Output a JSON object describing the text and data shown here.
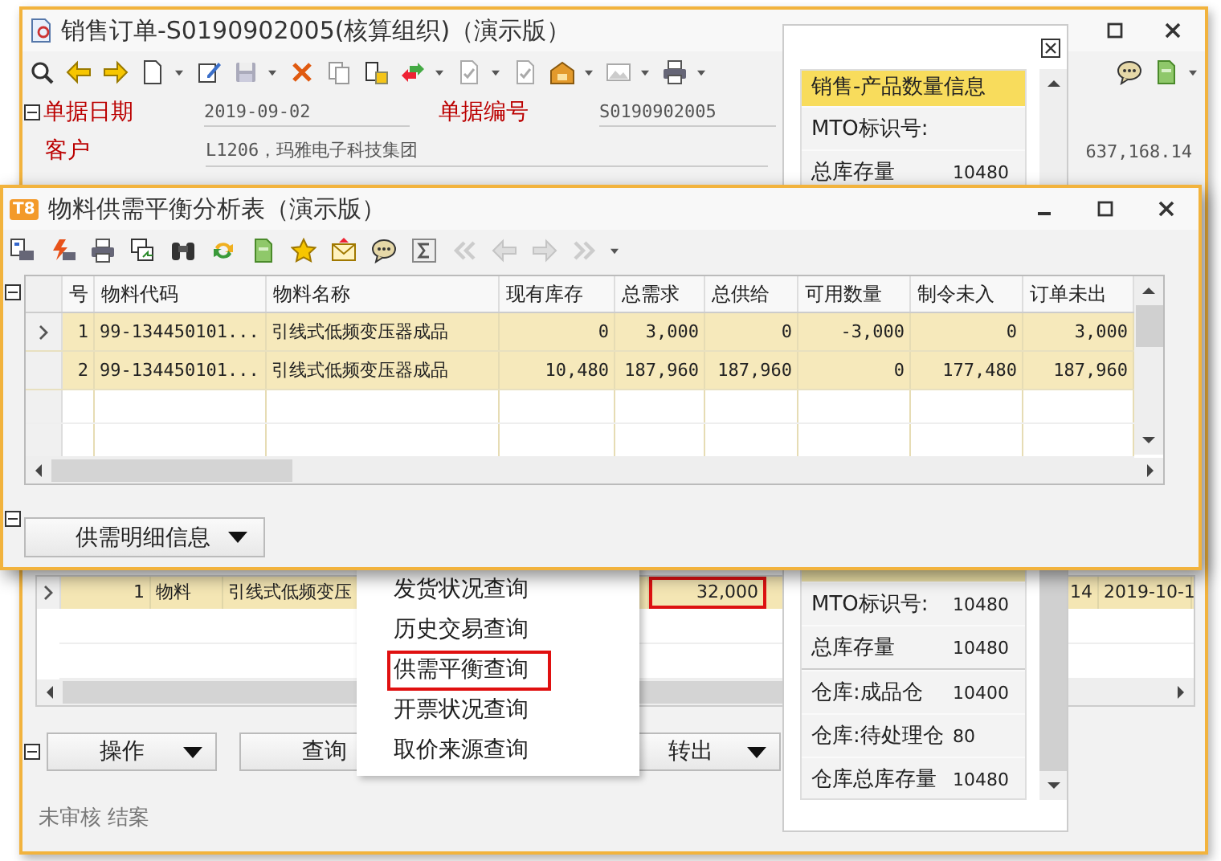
{
  "order_window": {
    "title": "销售订单-S0190902005(核算组织)（演示版）",
    "fields": [
      {
        "label": "单据日期",
        "value": "2019-09-02"
      },
      {
        "label": "单据编号",
        "value": "S0190902005"
      },
      {
        "label": "客户",
        "value": "L1206，玛雅电子科技集团"
      }
    ],
    "amount": "637,168.14",
    "grid_row": {
      "current": true,
      "cells": [
        {
          "text": "1",
          "highlighted": false
        },
        {
          "text": "物料",
          "highlighted": false
        },
        {
          "text": "引线式低频变压",
          "highlighted": false
        },
        {
          "text": "32,000",
          "highlighted": true
        },
        {
          "text": "14",
          "highlighted": false
        },
        {
          "text": "2019-10-1",
          "highlighted": false
        }
      ]
    },
    "buttons": [
      {
        "label": "操作",
        "dropdown": true
      },
      {
        "label": "查询",
        "dropdown": false
      },
      {
        "label": "转出",
        "dropdown": true
      }
    ],
    "status": "未审核 结案"
  },
  "info_panel": {
    "title": "销售-产品数量信息",
    "top_rows": [
      {
        "label": "MTO标识号:"
      },
      {
        "label": "总库存量",
        "value": "10480"
      }
    ],
    "bottom_rows": [
      {
        "label": "MTO标识号:",
        "value": "10480"
      },
      {
        "label": "总库存量",
        "value": "10480"
      }
    ],
    "warehouse_rows": [
      {
        "label": "仓库:成品仓",
        "value": "10400"
      },
      {
        "label": "仓库:待处理仓",
        "value": "80"
      },
      {
        "label": "仓库总库存量",
        "value": "10480"
      }
    ]
  },
  "context_menu": {
    "items": [
      {
        "label": "发货状况查询",
        "selected": false
      },
      {
        "label": "历史交易查询",
        "selected": false
      },
      {
        "label": "供需平衡查询",
        "selected": true
      },
      {
        "label": "开票状况查询",
        "selected": false
      },
      {
        "label": "取价来源查询",
        "selected": false
      }
    ]
  },
  "analysis_window": {
    "logo": "T8",
    "title": "物料供需平衡分析表（演示版）",
    "columns": [
      "号",
      "物料代码",
      "物料名称",
      "现有库存",
      "总需求",
      "总供给",
      "可用数量",
      "制令未入",
      "订单未出"
    ],
    "rows": [
      {
        "current": true,
        "cells": [
          "1",
          "99-134450101...",
          "引线式低频变压器成品",
          "0",
          "3,000",
          "0",
          "-3,000",
          "0",
          "3,000"
        ]
      },
      {
        "current": false,
        "cells": [
          "2",
          "99-134450101...",
          "引线式低频变压器成品",
          "10,480",
          "187,960",
          "187,960",
          "0",
          "177,480",
          "187,960"
        ]
      }
    ],
    "detail_button": "供需明细信息"
  }
}
